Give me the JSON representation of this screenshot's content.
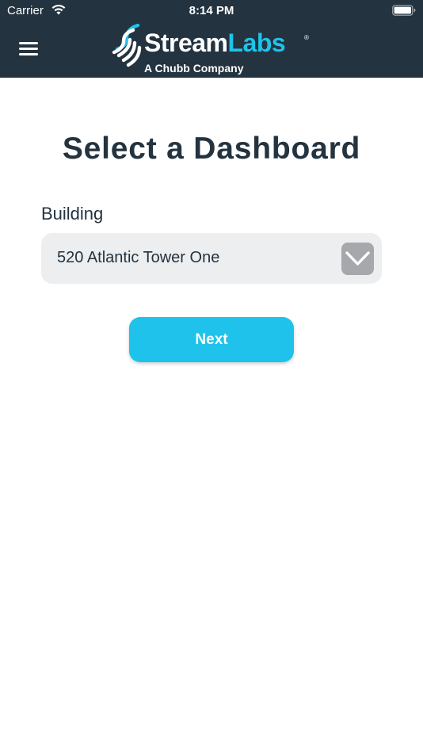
{
  "status_bar": {
    "carrier": "Carrier",
    "time": "8:14 PM",
    "wifi_icon": "wifi-icon",
    "battery_icon": "battery-full-icon"
  },
  "header": {
    "menu_icon": "hamburger-menu-icon",
    "logo": {
      "stream": "Stream",
      "labs": "Labs",
      "registered": "®",
      "subtitle": "A Chubb Company"
    },
    "background_color": "#23333f",
    "accent_color": "#1fc2ea"
  },
  "main": {
    "title": "Select a Dashboard",
    "building_label": "Building",
    "building_value": "520 Atlantic Tower One",
    "dropdown_icon": "chevron-down-icon",
    "next_label": "Next"
  }
}
